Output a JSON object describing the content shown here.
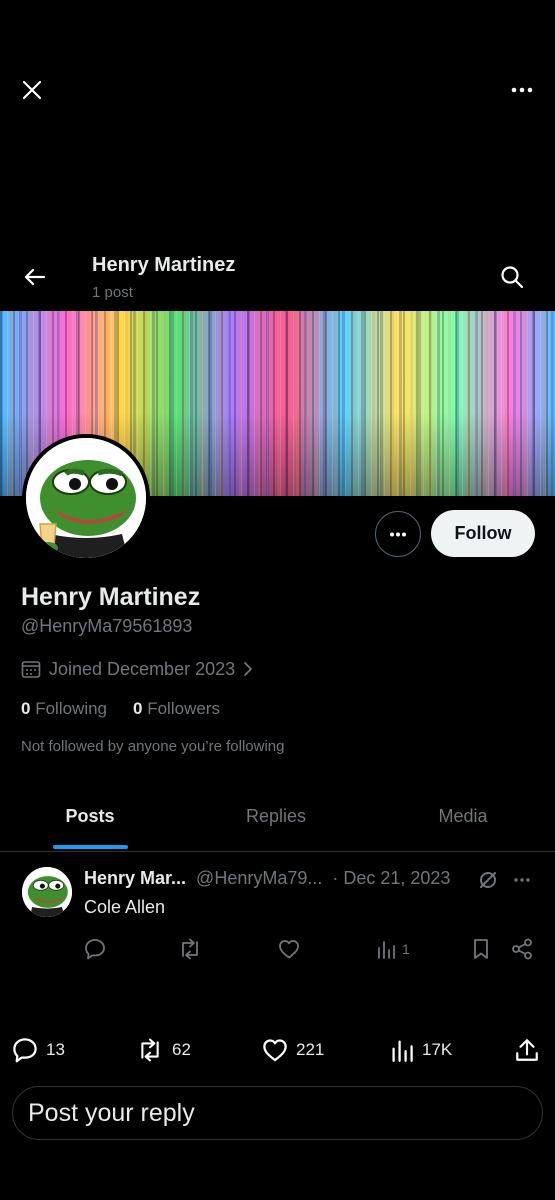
{
  "header": {
    "profile_name": "Henry Martinez",
    "post_count": "1 post"
  },
  "profile": {
    "display_name": "Henry Martinez",
    "handle": "@HenryMa79561893",
    "joined": "Joined December 2023",
    "following_count": "0",
    "following_label": "Following",
    "followers_count": "0",
    "followers_label": "Followers",
    "not_followed_text": "Not followed by anyone you’re following",
    "follow_label": "Follow"
  },
  "tabs": [
    {
      "label": "Posts",
      "active": true
    },
    {
      "label": "Replies",
      "active": false
    },
    {
      "label": "Media",
      "active": false
    }
  ],
  "post": {
    "author_name": "Henry Mar...",
    "author_handle": "@HenryMa79...",
    "date": "· Dec 21, 2023",
    "text": "Cole Allen",
    "views": "1"
  },
  "bottom_stats": {
    "replies": "13",
    "reposts": "62",
    "likes": "221",
    "views": "17K"
  },
  "reply": {
    "placeholder": "Post your reply"
  },
  "icons": [
    "close-icon",
    "more-icon",
    "back-arrow-icon",
    "search-icon",
    "calendar-icon",
    "chevron-right-icon",
    "reply-icon",
    "repost-icon",
    "like-icon",
    "views-icon",
    "bookmark-icon",
    "share-icon",
    "upload-icon",
    "grok-icon"
  ],
  "colors": {
    "background": "#000000",
    "text_primary": "#e7e9ea",
    "text_secondary": "#71767b",
    "accent": "#1d9bf0",
    "follow_button_bg": "#eff3f4"
  }
}
